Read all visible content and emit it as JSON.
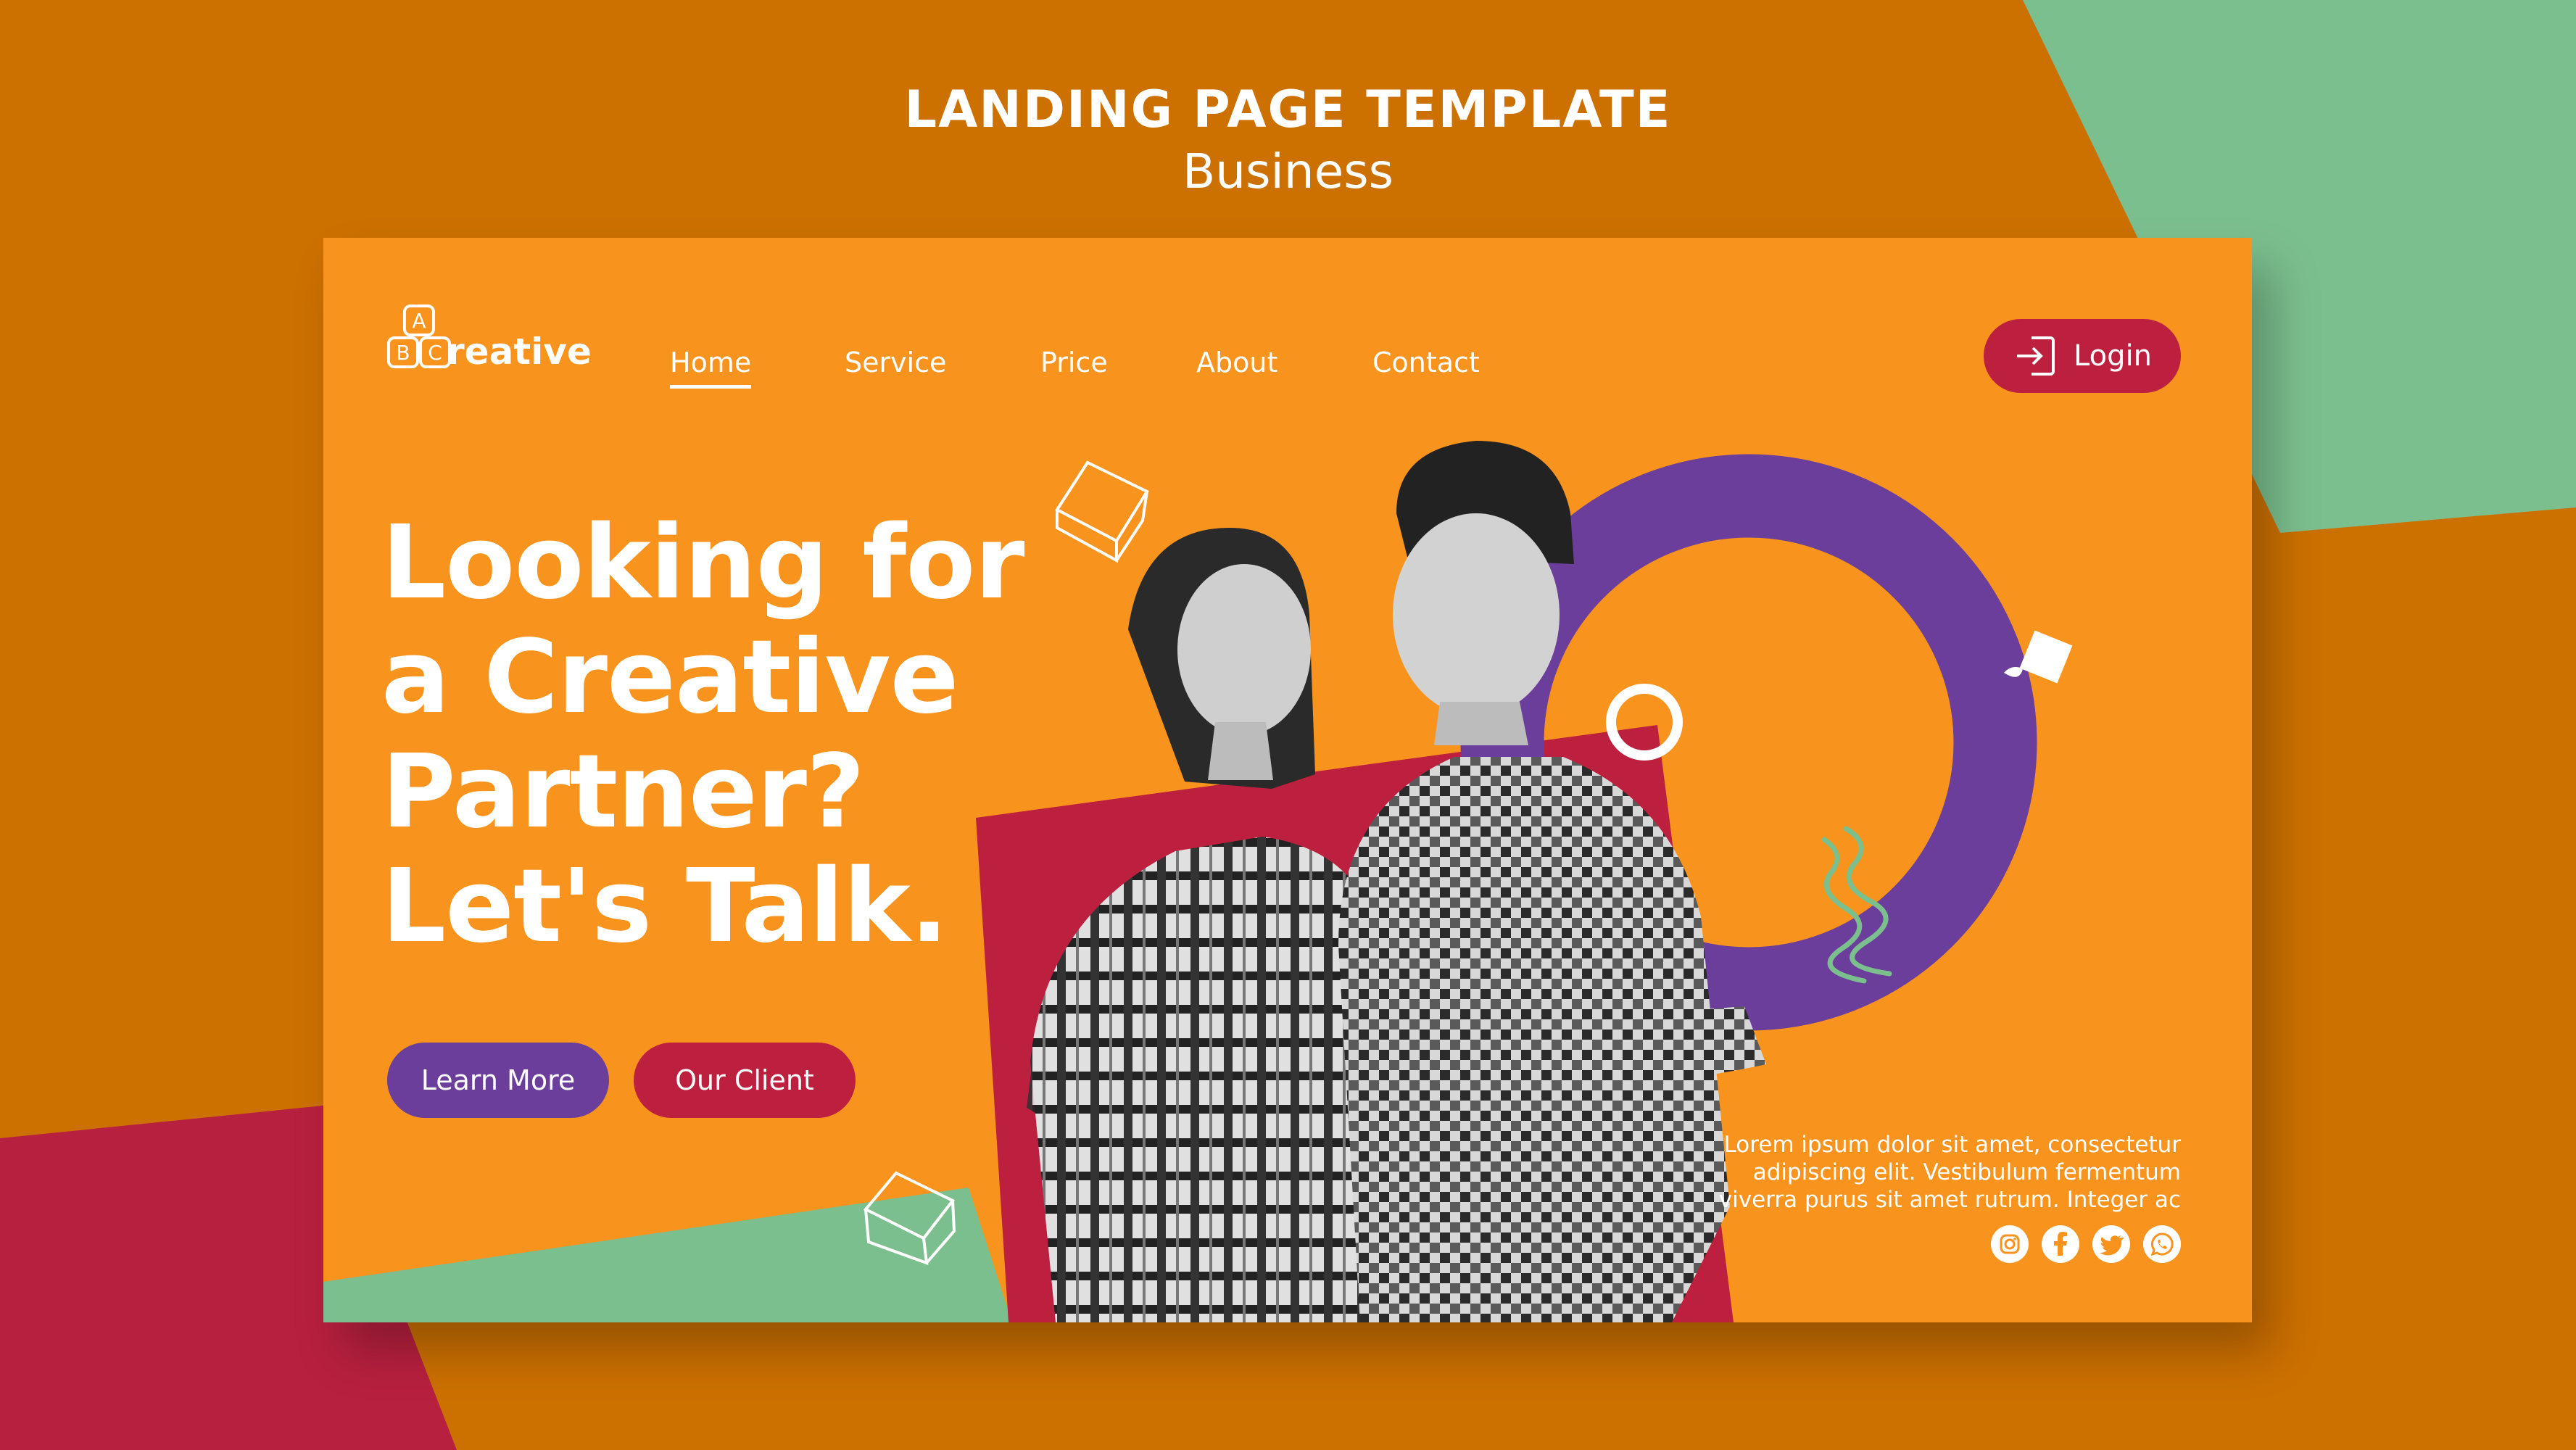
{
  "header": {
    "title": "LANDING PAGE TEMPLATE",
    "subtitle": "Business"
  },
  "brand": {
    "logo_letters": [
      "A",
      "B",
      "C"
    ],
    "logo_text": "reative"
  },
  "nav": {
    "items": [
      {
        "label": "Home",
        "active": true
      },
      {
        "label": "Service",
        "active": false
      },
      {
        "label": "Price",
        "active": false
      },
      {
        "label": "About",
        "active": false
      },
      {
        "label": "Contact",
        "active": false
      }
    ],
    "login_label": "Login",
    "login_icon": "login-arrow-icon"
  },
  "hero": {
    "headline_lines": [
      "Looking for",
      "a Creative",
      "Partner?",
      "Let's Talk."
    ],
    "primary_button": "Learn More",
    "secondary_button": "Our Client",
    "body_text_lines": [
      "Lorem ipsum dolor sit amet, consectetur",
      "adipiscing elit. Vestibulum fermentum",
      "viverra purus sit amet rutrum. Integer ac"
    ]
  },
  "social": {
    "icons": [
      "instagram-icon",
      "facebook-icon",
      "twitter-icon",
      "whatsapp-icon"
    ]
  },
  "colors": {
    "background": "#cc7000",
    "card": "#f8931d",
    "mint": "#7cbf8e",
    "crimson": "#bd1f3f",
    "purple": "#6a3e9a",
    "text": "#ffffff"
  }
}
